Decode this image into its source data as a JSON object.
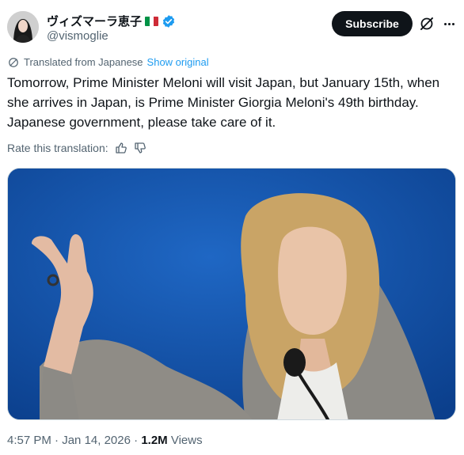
{
  "author": {
    "display_name": "ヴィズマーラ恵子",
    "handle": "@vismoglie",
    "flag": "italy-flag",
    "verified": true,
    "avatar": "avatar-image"
  },
  "actions": {
    "subscribe_label": "Subscribe",
    "grok_icon": "grok-icon",
    "more_icon": "more-icon"
  },
  "translation": {
    "label": "Translated from Japanese",
    "show_original": "Show original",
    "rate_label": "Rate this translation:"
  },
  "tweet": {
    "text": "Tomorrow, Prime Minister Meloni will visit Japan, but January 15th, when she arrives in Japan, is Prime Minister Giorgia Meloni's 49th birthday. Japanese government, please take care of it."
  },
  "meta": {
    "time": "4:57 PM",
    "separator": " · ",
    "date": "Jan 14, 2026",
    "views_count": "1.2M",
    "views_label": " Views"
  },
  "colors": {
    "accent": "#1d9bf0",
    "text": "#0f1419",
    "secondary": "#536471",
    "button_bg": "#0f1419"
  }
}
